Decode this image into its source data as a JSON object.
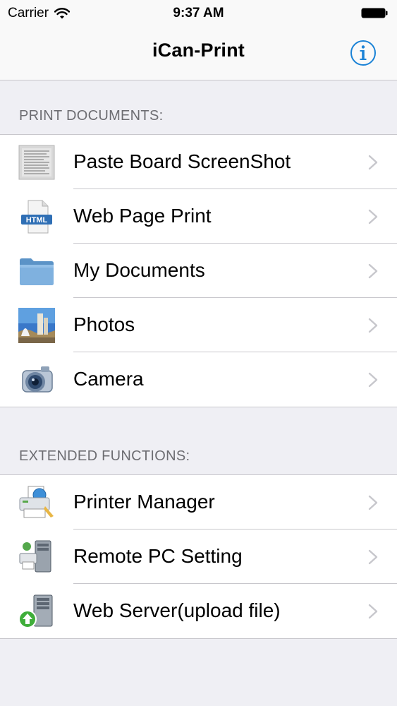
{
  "status_bar": {
    "carrier": "Carrier",
    "time": "9:37 AM"
  },
  "nav": {
    "title": "iCan-Print"
  },
  "sections": [
    {
      "header": "PRINT DOCUMENTS:",
      "items": [
        {
          "label": "Paste Board ScreenShot",
          "icon": "paste-board-icon"
        },
        {
          "label": "Web Page Print",
          "icon": "html-file-icon",
          "icon_text": "HTML"
        },
        {
          "label": "My Documents",
          "icon": "folder-icon"
        },
        {
          "label": "Photos",
          "icon": "photos-icon"
        },
        {
          "label": "Camera",
          "icon": "camera-icon"
        }
      ]
    },
    {
      "header": "EXTENDED FUNCTIONS:",
      "items": [
        {
          "label": "Printer Manager",
          "icon": "printer-icon"
        },
        {
          "label": "Remote PC Setting",
          "icon": "remote-pc-icon"
        },
        {
          "label": "Web Server(upload file)",
          "icon": "web-server-icon"
        }
      ]
    }
  ],
  "colors": {
    "tint": "#1a82d6",
    "background": "#efeff4",
    "separator": "#c8c7cc",
    "section_header": "#6d6d72",
    "chevron": "#c7c7cc"
  }
}
